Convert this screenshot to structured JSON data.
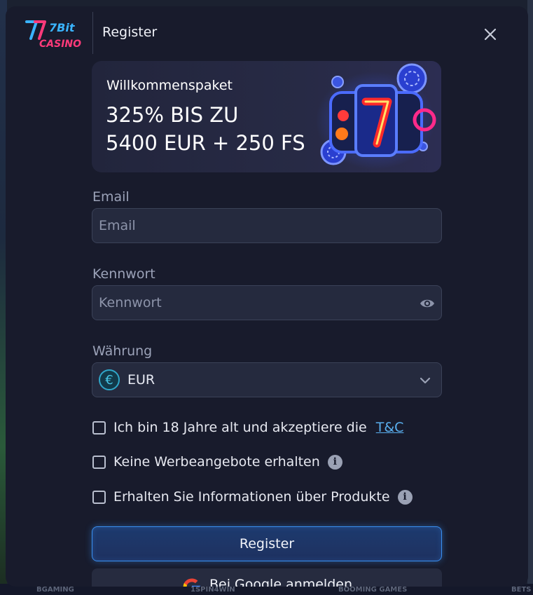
{
  "header": {
    "logo_top": "7Bit",
    "logo_bottom": "CASINO",
    "title": "Register"
  },
  "promo": {
    "label": "Willkommenspaket",
    "line1": "325% BIS ZU",
    "line2": "5400 EUR + 250 FS"
  },
  "form": {
    "email_label": "Email",
    "email_placeholder": "Email",
    "password_label": "Kennwort",
    "password_placeholder": "Kennwort",
    "currency_label": "Währung",
    "currency_symbol": "€",
    "currency_value": "EUR"
  },
  "checks": {
    "age_text": "Ich bin 18 Jahre alt und akzeptiere die",
    "age_link": "T&C",
    "no_promo_text": "Keine Werbeangebote erhalten",
    "info_text": "Erhalten Sie Informationen über Produkte"
  },
  "buttons": {
    "register": "Register",
    "google": "Bei Google anmelden"
  },
  "background": {
    "providers": [
      "BGAMING",
      "1SPIN4WIN",
      "BOOMING GAMES",
      "BETS"
    ]
  },
  "colors": {
    "accent": "#3a8ff0",
    "link": "#5ab0f0",
    "modal_bg": "#181b2c"
  }
}
